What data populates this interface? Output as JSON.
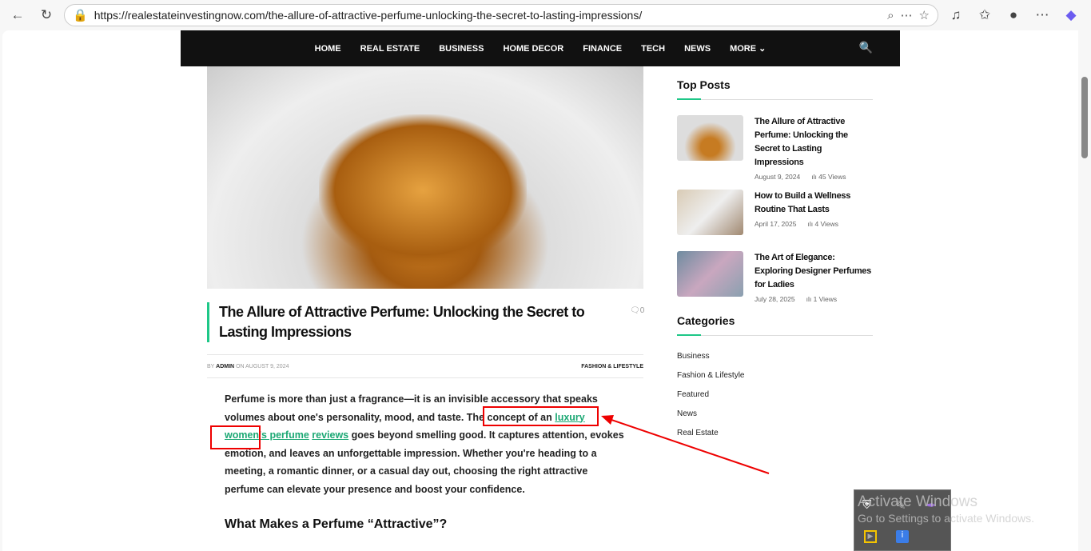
{
  "browser": {
    "url": "https://realestateinvestingnow.com/the-allure-of-attractive-perfume-unlocking-the-secret-to-lasting-impressions/"
  },
  "nav": {
    "items": [
      "HOME",
      "REAL ESTATE",
      "BUSINESS",
      "HOME DECOR",
      "FINANCE",
      "TECH",
      "NEWS",
      "MORE ⌄"
    ]
  },
  "article": {
    "title": "The Allure of Attractive Perfume: Unlocking the Secret to Lasting Impressions",
    "comments": "0",
    "by": "BY",
    "author": "ADMIN",
    "on": "ON AUGUST 9, 2024",
    "category": "FASHION & LIFESTYLE",
    "p1_a": "Perfume is more than just a fragrance—it is an invisible accessory that speaks volumes about one's personality, mood, and taste. The concept of an ",
    "link1": "luxury women's perfume",
    "link2": "reviews",
    "p1_b": " goes beyond smelling good. It captures attention, evokes emotion, and leaves an unforgettable impression. Whether you're heading to a meeting, a romantic dinner, or a casual day out, choosing the right attractive perfume can elevate your presence and boost your confidence.",
    "h2": "What Makes a Perfume “Attractive”?"
  },
  "sidebar": {
    "top_posts_title": "Top Posts",
    "posts": [
      {
        "title": "The Allure of Attractive Perfume: Unlocking the Secret to Lasting Impressions",
        "date": "August 9, 2024",
        "views": "45 Views"
      },
      {
        "title": "How to Build a Wellness Routine That Lasts",
        "date": "April 17, 2025",
        "views": "4 Views"
      },
      {
        "title": "The Art of Elegance: Exploring Designer Perfumes for Ladies",
        "date": "July 28, 2025",
        "views": "1 Views"
      }
    ],
    "categories_title": "Categories",
    "categories": [
      "Business",
      "Fashion & Lifestyle",
      "Featured",
      "News",
      "Real Estate"
    ]
  },
  "watermark": {
    "line1": "Activate Windows",
    "line2": "Go to Settings to activate Windows."
  }
}
